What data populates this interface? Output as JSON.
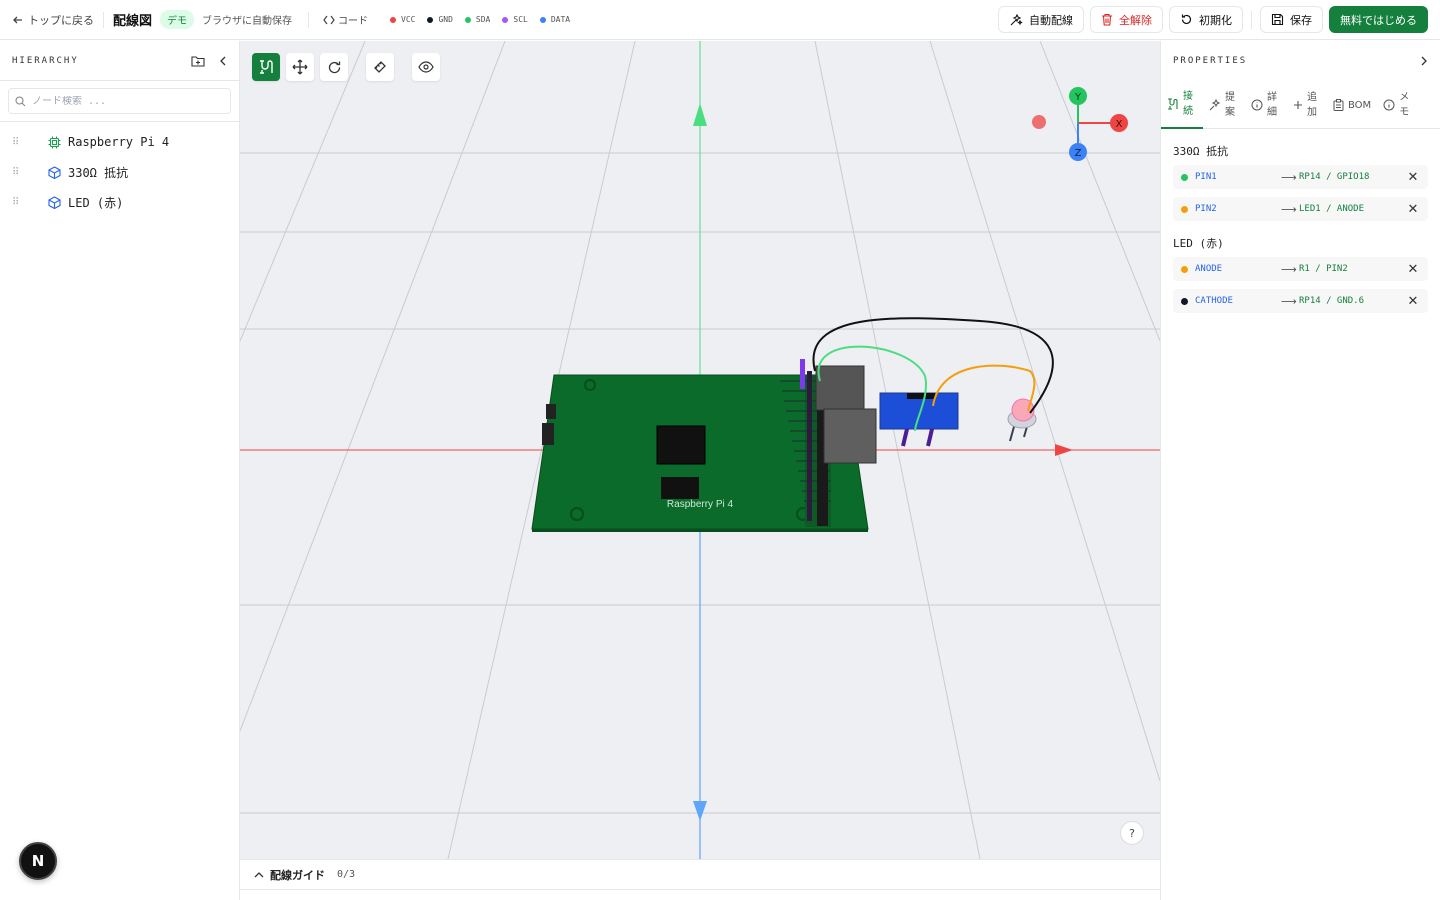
{
  "topbar": {
    "back_label": "トップに戻る",
    "title": "配線図",
    "badge": "デモ",
    "autosave": "ブラウザに自動保存",
    "code_label": "コード",
    "legend": [
      {
        "label": "VCC",
        "color": "#ef4444"
      },
      {
        "label": "GND",
        "color": "#111827"
      },
      {
        "label": "SDA",
        "color": "#22c55e"
      },
      {
        "label": "SCL",
        "color": "#a855f7"
      },
      {
        "label": "DATA",
        "color": "#3b82f6"
      }
    ],
    "auto_wire_label": "自動配線",
    "clear_all_label": "全解除",
    "reset_label": "初期化",
    "save_label": "保存",
    "start_free_label": "無料ではじめる"
  },
  "hierarchy": {
    "title": "HIERARCHY",
    "search_placeholder": "ノード検索 ...",
    "items": [
      {
        "label": "Raspberry Pi 4",
        "icon": "chip-icon"
      },
      {
        "label": "330Ω 抵抗",
        "icon": "cube-icon"
      },
      {
        "label": "LED (赤)",
        "icon": "cube-icon"
      }
    ]
  },
  "viewport": {
    "board_label": "Raspberry Pi 4",
    "axis_labels": {
      "y": "Y",
      "x": "X",
      "z": "Z"
    },
    "help": "?"
  },
  "guide": {
    "title": "配線ガイド",
    "count": "0/3"
  },
  "properties": {
    "title": "PROPERTIES",
    "tabs": [
      {
        "label": "接続",
        "icon": "connection-icon"
      },
      {
        "label": "提案",
        "icon": "sparkle-icon"
      },
      {
        "label": "詳細",
        "icon": "info-icon"
      },
      {
        "label": "追加",
        "icon": "plus-icon"
      },
      {
        "label": "BOM",
        "icon": "clipboard-icon"
      },
      {
        "label": "メモ",
        "icon": "info-icon"
      }
    ],
    "groups": [
      {
        "title": "330Ω 抵抗",
        "connections": [
          {
            "pin": "PIN1",
            "color": "#22c55e",
            "target": "RP14 / GPIO18"
          },
          {
            "pin": "PIN2",
            "color": "#f59e0b",
            "target": "LED1 / ANODE"
          }
        ]
      },
      {
        "title": "LED (赤)",
        "connections": [
          {
            "pin": "ANODE",
            "color": "#f59e0b",
            "target": "R1 / PIN2"
          },
          {
            "pin": "CATHODE",
            "color": "#111827",
            "target": "RP14 / GND.6"
          }
        ]
      }
    ]
  },
  "next_badge": "N"
}
